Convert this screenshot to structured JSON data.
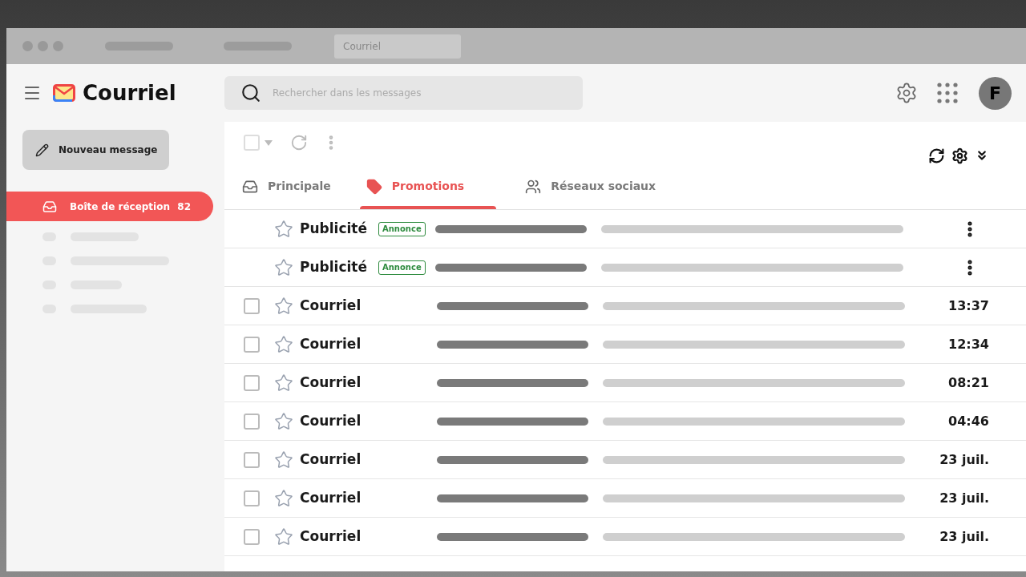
{
  "browser": {
    "tab_title": "Courriel"
  },
  "app": {
    "title": "Courriel",
    "avatar": "F"
  },
  "search": {
    "placeholder": "Rechercher dans les messages"
  },
  "compose": {
    "label": "Nouveau message"
  },
  "sidebar": {
    "items": [
      {
        "label": "Boîte de réception",
        "count": "82",
        "selected": true
      }
    ]
  },
  "toolbar": {
    "select_all_checked": false
  },
  "tabs": [
    {
      "label": "Principale",
      "kind": "inbox",
      "selected": false
    },
    {
      "label": "Promotions",
      "kind": "tag",
      "selected": true
    },
    {
      "label": "Réseaux sociaux",
      "kind": "people",
      "selected": false
    }
  ],
  "messages": [
    {
      "kind": "ad",
      "sender": "Publicité",
      "badge": "Annonce",
      "starred": false
    },
    {
      "kind": "ad",
      "sender": "Publicité",
      "badge": "Annonce",
      "starred": false
    },
    {
      "kind": "mail",
      "sender": "Courriel",
      "time": "13:37",
      "starred": false,
      "checked": false
    },
    {
      "kind": "mail",
      "sender": "Courriel",
      "time": "12:34",
      "starred": false,
      "checked": false
    },
    {
      "kind": "mail",
      "sender": "Courriel",
      "time": "08:21",
      "starred": false,
      "checked": false
    },
    {
      "kind": "mail",
      "sender": "Courriel",
      "time": "04:46",
      "starred": false,
      "checked": false
    },
    {
      "kind": "mail",
      "sender": "Courriel",
      "time": "23 juil.",
      "starred": false,
      "checked": false
    },
    {
      "kind": "mail",
      "sender": "Courriel",
      "time": "23 juil.",
      "starred": false,
      "checked": false
    },
    {
      "kind": "mail",
      "sender": "Courriel",
      "time": "23 juil.",
      "starred": false,
      "checked": false
    }
  ]
}
